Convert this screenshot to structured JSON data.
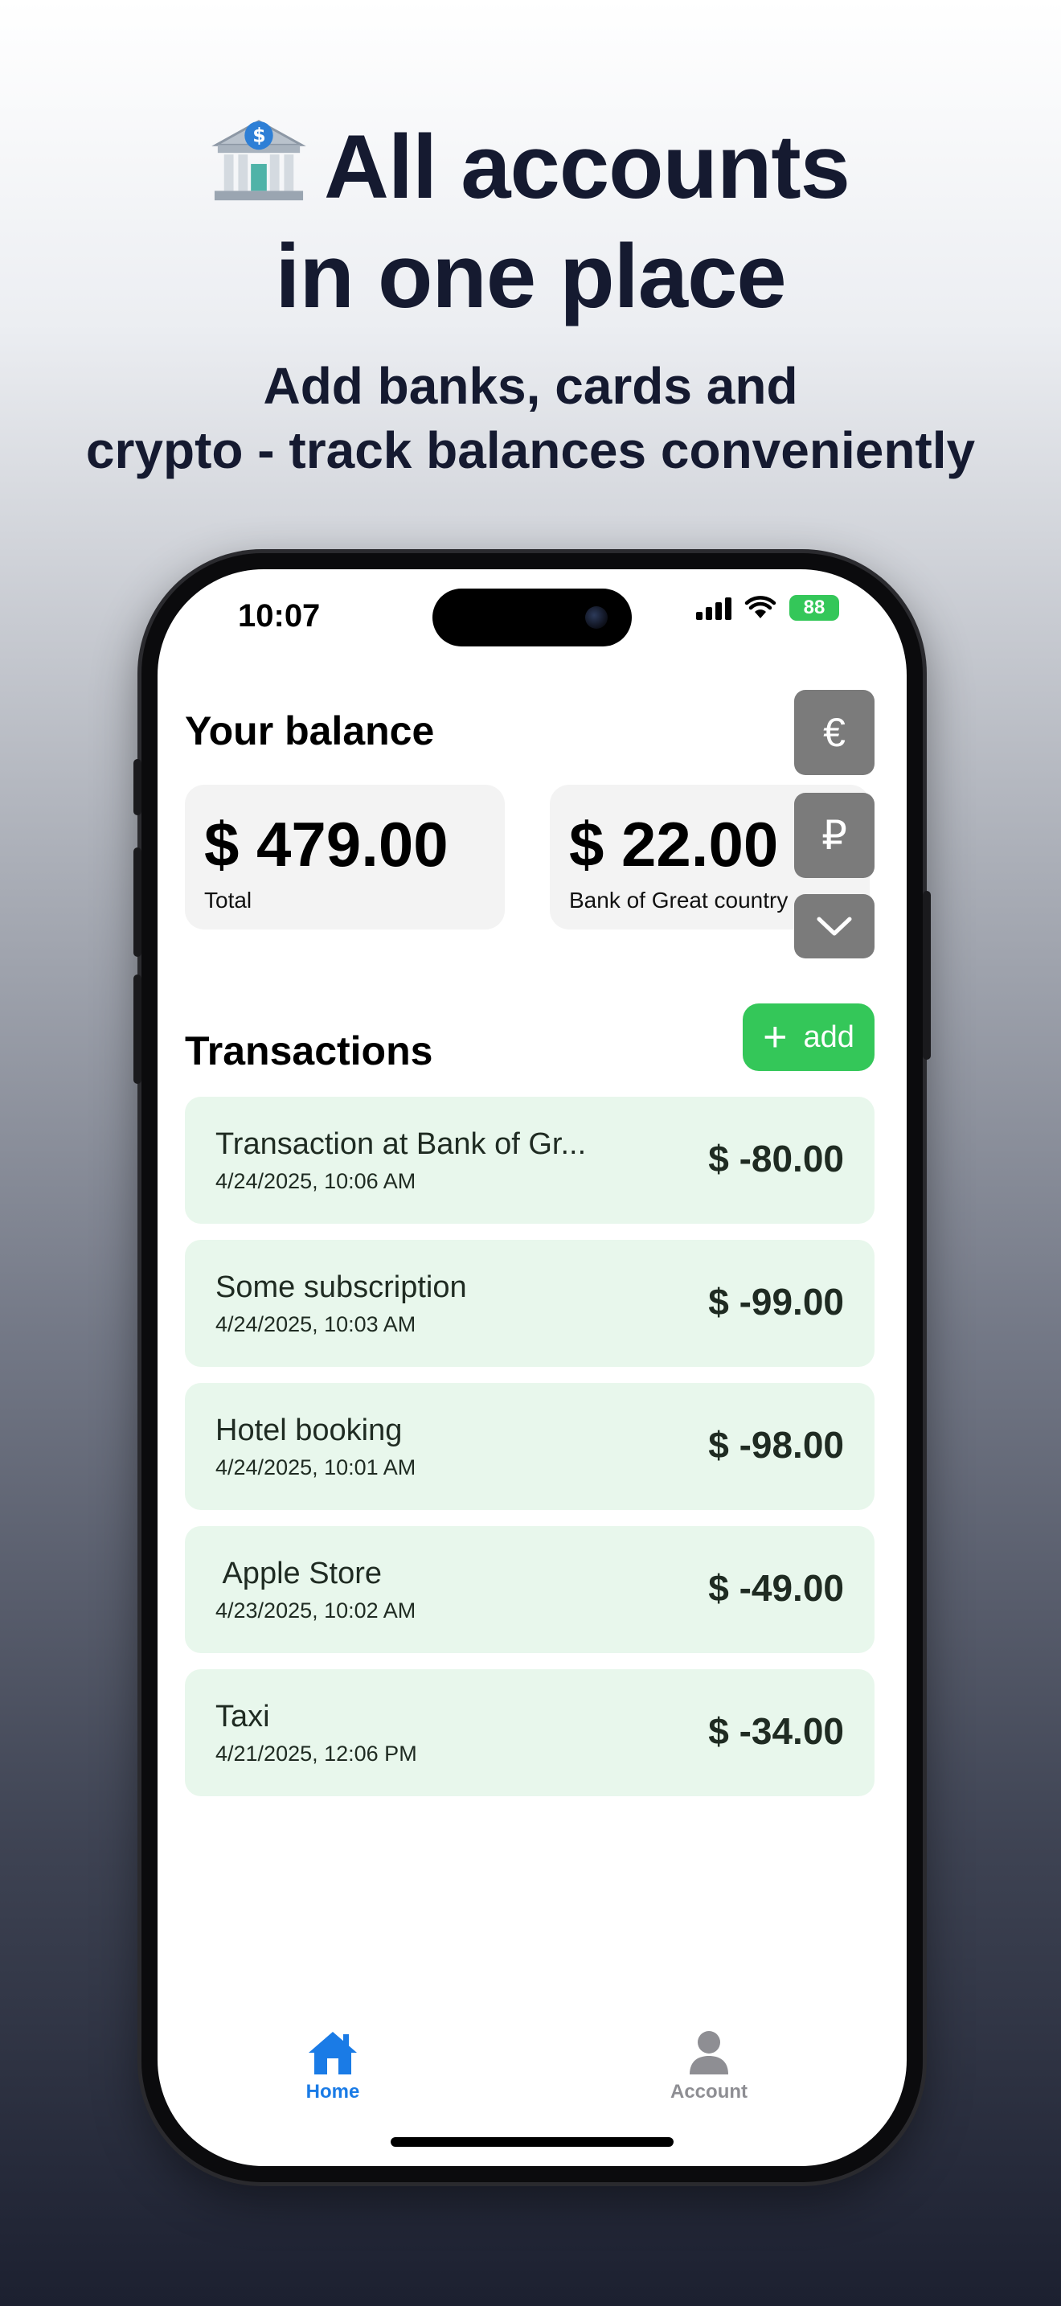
{
  "marketing": {
    "headline_line1": "All accounts",
    "headline_line2": "in one place",
    "subline_line1": "Add banks, cards and",
    "subline_line2": "crypto - track balances conveniently",
    "bank_icon": "bank-building-icon"
  },
  "status_bar": {
    "time": "10:07",
    "battery": "88"
  },
  "balance": {
    "title": "Your balance",
    "cards": [
      {
        "amount": "$ 479.00",
        "label": "Total"
      },
      {
        "amount": "$ 22.00",
        "label": "Bank of Great country"
      }
    ],
    "currency_buttons": [
      "€",
      "₽"
    ],
    "expand_icon": "chevron-down-icon"
  },
  "transactions": {
    "title": "Transactions",
    "add_label": "add",
    "items": [
      {
        "name": "Transaction at Bank of Gr...",
        "date": "4/24/2025, 10:06 AM",
        "amount": "$ -80.00"
      },
      {
        "name": "Some subscription",
        "date": "4/24/2025, 10:03 AM",
        "amount": "$ -99.00"
      },
      {
        "name": "Hotel booking",
        "date": "4/24/2025, 10:01 AM",
        "amount": "$ -98.00"
      },
      {
        "name": " Apple Store",
        "date": "4/23/2025, 10:02 AM",
        "amount": "$ -49.00"
      },
      {
        "name": "Taxi",
        "date": "4/21/2025, 12:06 PM",
        "amount": "$ -34.00"
      }
    ]
  },
  "tabs": {
    "home": {
      "label": "Home",
      "color": "#1a7be6"
    },
    "account": {
      "label": "Account",
      "color": "#8e8e93"
    }
  },
  "colors": {
    "accent_green": "#34c759",
    "tx_background": "#e8f7ec",
    "headline": "#151a30"
  }
}
